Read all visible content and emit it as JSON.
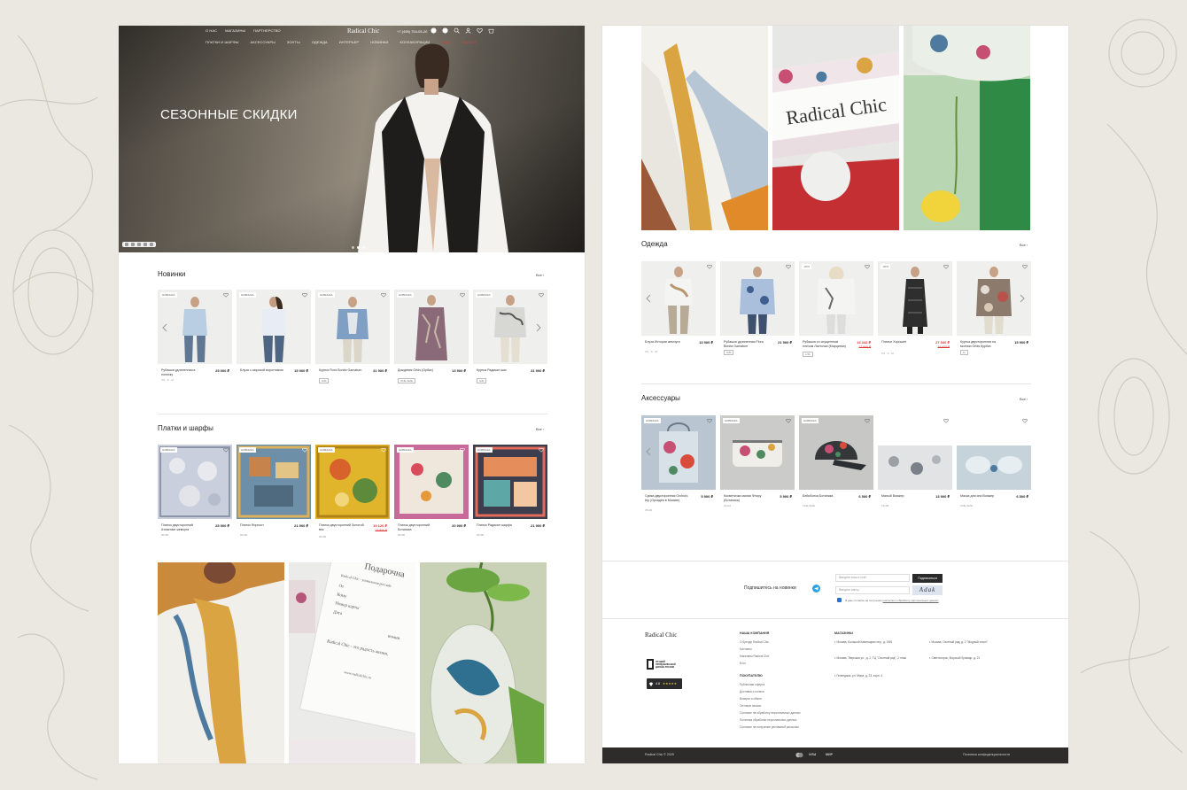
{
  "left_page": {
    "header": {
      "top_links": [
        "О НАС",
        "МАГАЗИНЫ",
        "ПАРТНЕРСТВО"
      ],
      "logo": "Radical Chic",
      "phone": "+7 (495) 754-05-20",
      "nav": [
        "ПЛАТКИ И ШАРФЫ",
        "АКСЕССУАРЫ",
        "ЗОНТЫ",
        "ОДЕЖДА",
        "ИНТЕРЬЕР",
        "НОВИНКИ",
        "КОЛЛАБОРАЦИИ",
        "SALE",
        "OUTLET"
      ]
    },
    "hero": {
      "title": "СЕЗОННЫЕ СКИДКИ"
    },
    "novinki": {
      "title": "Новинки",
      "all_link": "Все",
      "products": [
        {
          "badge": "НОВИНКА",
          "name": "Рубашка удлиненная в полоску",
          "price": "25 900 ₽",
          "sizes": "XS · S · M"
        },
        {
          "badge": "НОВИНКА",
          "name": "Блуза с широкой воротником",
          "price": "15 900 ₽",
          "sizes": ""
        },
        {
          "badge": "НОВИНКА",
          "name": "Куртка Flora Bonita Garnatum",
          "price": "31 900 ₽",
          "sizes": "S/M"
        },
        {
          "badge": "НОВИНКА",
          "name": "Дождевик Orbis (Орбис)",
          "price": "13 900 ₽",
          "sizes": "ONE SIZE"
        },
        {
          "badge": "НОВИНКА",
          "name": "Куртка Радикал шик",
          "price": "31 900 ₽",
          "sizes": "S/M"
        }
      ]
    },
    "platki": {
      "title": "Платки и шарфы",
      "all_link": "Все",
      "products": [
        {
          "badge": "НОВИНКА",
          "name": "Платок двусторонний Атласные жемчуга",
          "price": "25 900 ₽",
          "old_price": "",
          "size": "90х90"
        },
        {
          "badge": "НОВИНКА",
          "name": "Платок Форпост",
          "price": "21 900 ₽",
          "old_price": "",
          "size": "90х90"
        },
        {
          "badge": "НОВИНКА",
          "name": "Платок двусторонний Золотой век",
          "price": "19 120 ₽",
          "old_price": "23 900 ₽",
          "size": "90х90"
        },
        {
          "badge": "НОВИНКА",
          "name": "Платок двусторонний Ботаника",
          "price": "20 900 ₽",
          "old_price": "",
          "size": "90х90"
        },
        {
          "badge": "НОВИНКА",
          "name": "Платок Радикал шарфа",
          "price": "21 900 ₽",
          "old_price": "",
          "size": "90х90"
        }
      ]
    },
    "gift_card": {
      "title": "Подарочна",
      "lines": [
        "Radical Chic - уникальная российс",
        "От",
        "Кому",
        "Номер карты",
        "Дата",
        "номин",
        "Radical Chic - это радость жизни,",
        "www.radicalchic.ru"
      ]
    }
  },
  "right_page": {
    "photo_tiles": {
      "brand_on_card": "Radical Chic"
    },
    "odezhda": {
      "title": "Одежда",
      "all_link": "Все",
      "products": [
        {
          "badge": "",
          "name": "Блуза Истории жемчуга",
          "price": "13 900 ₽",
          "old_price": "",
          "sizes": "XS · S · M"
        },
        {
          "badge": "",
          "name": "Рубашка удлиненная Flora Bonita Garnatum",
          "price": "21 900 ₽",
          "old_price": "",
          "sizes": "S/M"
        },
        {
          "badge": "-20%",
          "name": "Рубашка со спущенным плечом Ласточка (Марципан)",
          "price": "14 342 ₽",
          "old_price": "17 900 ₽",
          "sizes": "L/XL"
        },
        {
          "badge": "-20%",
          "name": "Платье Хорошее",
          "price": "27 540 ₽",
          "old_price": "34 600 ₽",
          "sizes": "XS · S · M"
        },
        {
          "badge": "",
          "name": "Куртка двусторонняя на молнии Orbis Курбис",
          "price": "15 900 ₽",
          "old_price": "",
          "sizes": "M"
        }
      ]
    },
    "aksessuary": {
      "title": "Аксессуары",
      "all_link": "Все",
      "products": [
        {
          "badge": "НОВИНКА",
          "name": "Сумка двусторонняя Orchid's trip (Орхидея в Москве)",
          "price": "5 900 ₽",
          "note": "35х40"
        },
        {
          "badge": "НОВИНКА",
          "name": "Косметичка малая Флору (Ботаника)",
          "price": "5 900 ₽",
          "note": "20х10"
        },
        {
          "badge": "НОВИНКА",
          "name": "Бейсболка Ботаника",
          "price": "6 500 ₽",
          "note": "ONE SIZE"
        },
        {
          "badge": "",
          "name": "Малый Вояжер",
          "price": "13 900 ₽",
          "note": "13х28"
        },
        {
          "badge": "",
          "name": "Маска для сна Вояжер",
          "price": "6 500 ₽",
          "note": "ONE SIZE"
        }
      ]
    },
    "newsletter": {
      "label": "Подпишитесь на новинки",
      "email_placeholder": "Введите ваш e-mail",
      "captcha_placeholder": "Введите капчу",
      "submit": "Подписаться",
      "consent": "Я даю согласие на получение ",
      "consent_link": "рассылки и обработку персональных данных",
      "captcha_text": "Adak"
    },
    "footer": {
      "logo": "Radical Chic",
      "award": "ЛУЧШИЙ ПРОМЫШЛЕННЫЙ ДИЗАЙН РОССИИ",
      "rating": "4.8",
      "rating_stars": "★★★★★",
      "company_heading": "НАША КОМПАНИЯ",
      "company_links": [
        "О бренде Radical Chic",
        "Контакты",
        "Магазины Radical Chic",
        "Блог"
      ],
      "buyer_heading": "ПОКУПАТЕЛЮ",
      "buyer_links": [
        "Публичная оферта",
        "Доставка и оплата",
        "Возврат и обмен",
        "Оптовые заказы",
        "Согласие на обработку персональных данных",
        "Политика обработки персональных данных",
        "Согласие на получение рекламной рассылки"
      ],
      "stores_heading": "МАГАЗИНЫ",
      "stores": [
        "г. Москва, Большой Каменщики пер., д. 18/6",
        "г. Москва, Тверская ул., д. 2, ТЦ \"Охотный ряд\", 2 этаж",
        "г. Геленджик, ул. Мира, д. 23, корп. 4",
        "г. Москва, Охотный ряд, д. 2 \"Модный сезон\"",
        "г. Светлогорск, Морской бульвар, д. 21"
      ],
      "copyright": "Radical Chic © 2025",
      "pay": [
        "VISA",
        "МИР"
      ],
      "policy": "Политика конфиденциальности"
    }
  }
}
